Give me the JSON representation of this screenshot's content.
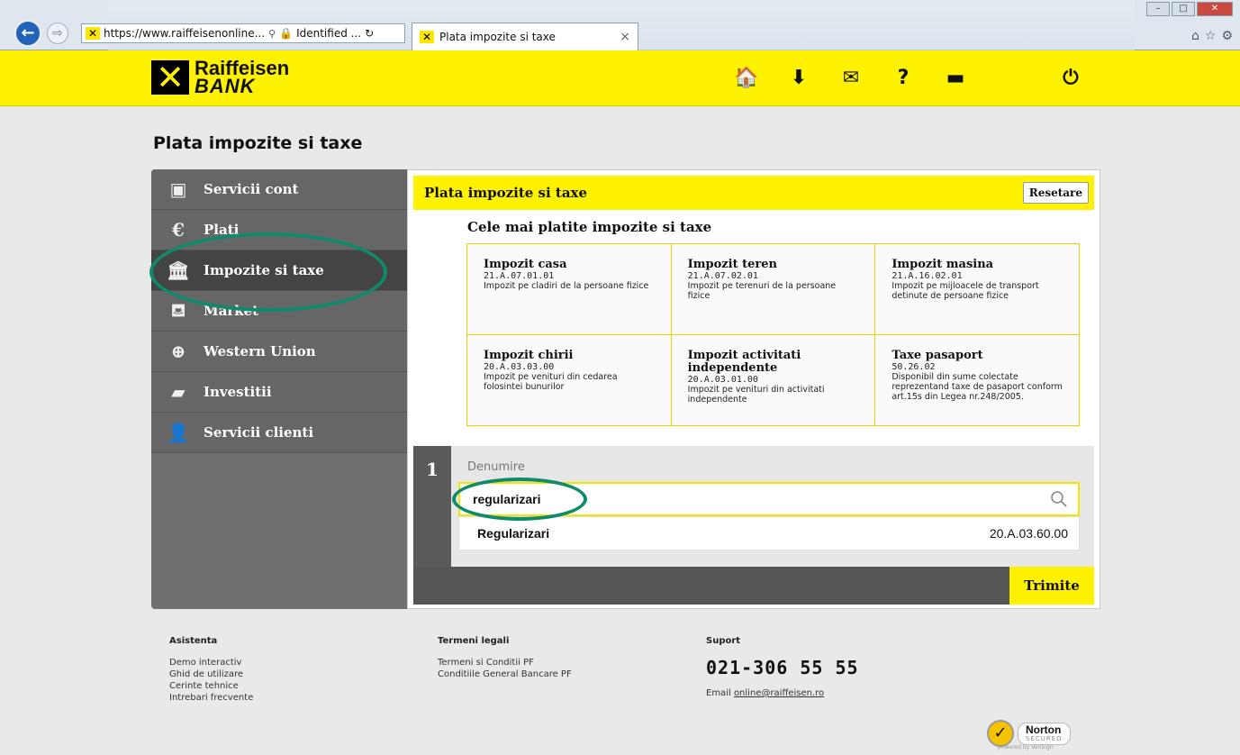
{
  "browser": {
    "url": "https://www.raiffeisenonline...",
    "search_symbol": "⚲",
    "identity": "Identified ...",
    "refresh_symbol": "↻",
    "tab_title": "Plata impozite si taxe",
    "tab_close": "×"
  },
  "brand": {
    "logo_symbol": "✕",
    "line1": "Raiffeisen",
    "line2": "BANK",
    "accent_color": "#fff200"
  },
  "header_icons": [
    {
      "icon": "home-icon",
      "glyph": "🏠"
    },
    {
      "icon": "download-icon",
      "glyph": "⬇"
    },
    {
      "icon": "mail-icon",
      "glyph": "✉"
    },
    {
      "icon": "help-icon",
      "glyph": "?"
    },
    {
      "icon": "print-icon",
      "glyph": "▬"
    },
    {
      "icon": "power-icon",
      "glyph": "⏻"
    }
  ],
  "page": {
    "title": "Plata impozite si taxe"
  },
  "sidebar": {
    "items": [
      {
        "label": "Servicii cont",
        "icon": "wallet-icon",
        "glyph": "▣"
      },
      {
        "label": "Plati",
        "icon": "currency-icon",
        "glyph": "€"
      },
      {
        "label": "Impozite si taxe",
        "icon": "institution-icon",
        "glyph": "🏛"
      },
      {
        "label": "Market",
        "icon": "basket-icon",
        "glyph": "⛾"
      },
      {
        "label": "Western Union",
        "icon": "globe-icon",
        "glyph": "⊕"
      },
      {
        "label": "Investitii",
        "icon": "gold-bars-icon",
        "glyph": "▰"
      },
      {
        "label": "Servicii clienti",
        "icon": "user-icon",
        "glyph": "👤"
      }
    ],
    "active_index": 2
  },
  "panel": {
    "title": "Plata impozite si taxe",
    "reset_label": "Resetare",
    "popular_title": "Cele mai platite impozite si taxe",
    "taxes": [
      {
        "name": "Impozit casa",
        "code": "21.A.07.01.01",
        "desc": "Impozit pe cladiri de la persoane fizice"
      },
      {
        "name": "Impozit teren",
        "code": "21.A.07.02.01",
        "desc": "Impozit pe terenuri de la persoane fizice"
      },
      {
        "name": "Impozit masina",
        "code": "21.A.16.02.01",
        "desc": "Impozit pe mijloacele de transport detinute de persoane fizice"
      },
      {
        "name": "Impozit chirii",
        "code": "20.A.03.03.00",
        "desc": "Impozit pe venituri din cedarea folosintei bunurilor"
      },
      {
        "name": "Impozit activitati independente",
        "code": "20.A.03.01.00",
        "desc": "Impozit pe venituri din activitati independente"
      },
      {
        "name": "Taxe pasaport",
        "code": "50.26.02",
        "desc": "Disponibil din sume colectate reprezentand taxe de pasaport conform art.15s din Legea nr.248/2005."
      }
    ],
    "step_number": "1",
    "field_label": "Denumire",
    "search_value": "regularizari",
    "suggestion": {
      "name": "Regularizari",
      "code": "20.A.03.60.00"
    },
    "submit_label": "Trimite"
  },
  "footer": {
    "asistenta": {
      "title": "Asistenta",
      "links": [
        "Demo interactiv",
        "Ghid de utilizare",
        "Cerinte tehnice",
        "Intrebari frecvente"
      ]
    },
    "termeni": {
      "title": "Termeni legali",
      "links": [
        "Termeni si Conditii PF",
        "Conditiile General Bancare PF"
      ]
    },
    "suport": {
      "title": "Suport",
      "phone": "021-306 55 55",
      "email_label": "Email",
      "email": "online@raiffeisen.ro"
    },
    "norton": {
      "check": "✓",
      "name": "Norton",
      "tagline": "SECURED",
      "powered": "powered by VeriSign"
    }
  },
  "annotation_color": "#0f8a6a"
}
